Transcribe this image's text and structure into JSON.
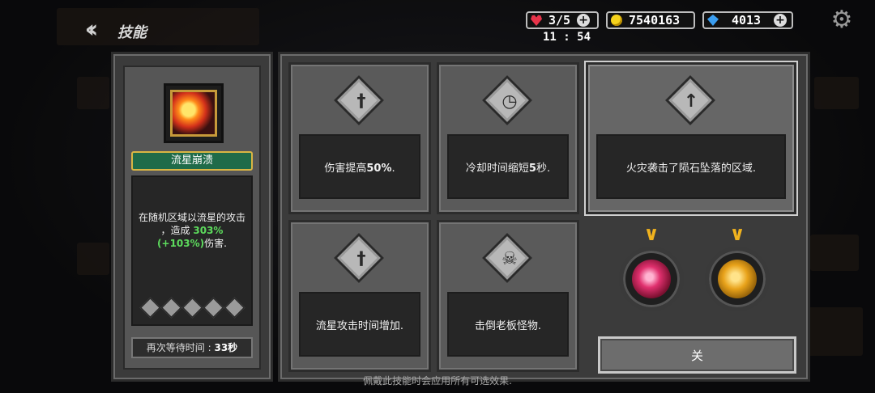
{
  "header": {
    "title": "技能",
    "back_icon": "double-chevron-left-icon",
    "lives": "3/5",
    "gold": "7540163",
    "gems": "4013",
    "timer": "11 : 54",
    "settings_icon": "gear-icon"
  },
  "skill": {
    "name": "流星崩溃",
    "desc_line1": "在随机区域以流星的攻击",
    "desc_line2a": "，造成 ",
    "desc_value": "303%",
    "desc_bonus": "(+103%)",
    "desc_line3": "伤害.",
    "cooldown_label": "再次等待时间 : ",
    "cooldown_value": "33秒"
  },
  "options": [
    {
      "icon": "sword-icon",
      "text_a": "伤害提高",
      "text_b": "50%",
      "text_c": "."
    },
    {
      "icon": "clock-icon",
      "text_a": "冷却时间缩短",
      "text_b": "5",
      "text_c": "秒."
    },
    {
      "icon": "sword-up-icon",
      "text_a": "火灾袭击了陨石坠落的区域.",
      "text_b": "",
      "text_c": ""
    },
    {
      "icon": "sword-clock-icon",
      "text_a": "流星攻击时间增加.",
      "text_b": "",
      "text_c": ""
    },
    {
      "icon": "skull-icon",
      "text_a": "击倒老板怪物.",
      "text_b": "",
      "text_c": ""
    }
  ],
  "close_label": "关",
  "footer": "佩戴此技能时会应用所有可选效果.",
  "colors": {
    "accent_gold": "#f0b21e",
    "name_green": "#1f6b49",
    "value_green": "#5ddc5d"
  }
}
